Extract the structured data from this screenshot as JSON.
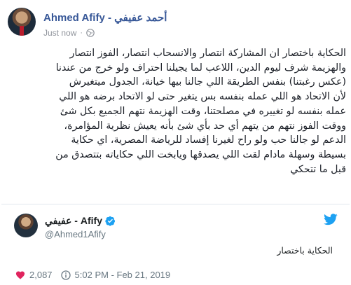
{
  "post": {
    "author": "Ahmed Afify - أحمد عفيفي",
    "timestamp": "Just now",
    "separator": "·",
    "privacy_icon": "globe-icon",
    "lines": [
      "الحكاية باختصار ان المشاركة انتصار والانسحاب انتصار، الفوز انتصار",
      "والهزيمة شرف ليوم الدين، اللاعب لما يجيلنا احتراف ولو خرج من عندنا",
      "(عكس رغبتنا) بنفس الطريقة اللي جالنا بيها خيانة، الجدول ميتغيرش",
      "لأن الاتحاد هو اللي عمله بنفسه بس يتغير حتى لو الاتحاد برضه هو اللي",
      "عمله بنفسه لو تغييره في مصلحتنا، وقت الهزيمة نتهم الجميع بكل شئ",
      "ووقت الفوز نتهم من يتهم أي حد بأي شئ بأنه يعيش نظرية المؤامرة،",
      "الدعم لو جالنا حب ولو راح لغيرنا إفساد للرياضة المصرية، اي حكاية",
      "بسيطة وسهلة مادام لقت اللي يصدقها ويابخت اللي حكاياته بتتصدق من",
      "قبل ما تتحكي"
    ]
  },
  "tweet": {
    "display_name": "عفيفي - Afify",
    "verified_icon": "verified-badge-icon",
    "handle": "@Ahmed1Afify",
    "brand_icon": "twitter-bird-icon",
    "text": "الحكاية باختصار",
    "likes": "2,087",
    "time_date": "5:02 PM - Feb 21, 2019",
    "colors": {
      "twitter_blue": "#1da1f2",
      "like_red": "#e0245e",
      "muted": "#697882"
    }
  }
}
